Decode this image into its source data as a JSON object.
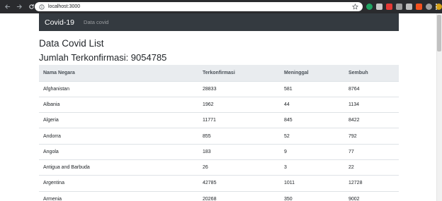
{
  "browser": {
    "url": "localhost:3000"
  },
  "navbar": {
    "brand": "Covid-19",
    "link": "Data covid"
  },
  "page": {
    "title": "Data Covid List",
    "total_label": "Jumlah Terkonfirmasi: 9054785"
  },
  "table": {
    "headers": [
      "Nama Negara",
      "Terkonfirmasi",
      "Meninggal",
      "Sembuh"
    ],
    "rows": [
      [
        "Afghanistan",
        "28833",
        "581",
        "8764"
      ],
      [
        "Albania",
        "1962",
        "44",
        "1134"
      ],
      [
        "Algeria",
        "11771",
        "845",
        "8422"
      ],
      [
        "Andorra",
        "855",
        "52",
        "792"
      ],
      [
        "Angola",
        "183",
        "9",
        "77"
      ],
      [
        "Antigua and Barbuda",
        "26",
        "3",
        "22"
      ],
      [
        "Argentina",
        "42785",
        "1011",
        "12728"
      ],
      [
        "Armenia",
        "20268",
        "350",
        "9002"
      ]
    ]
  },
  "colors": {
    "navbar_bg": "#343a40",
    "header_bg": "#e9ecef",
    "chrome_bg": "#2a2b2e"
  }
}
